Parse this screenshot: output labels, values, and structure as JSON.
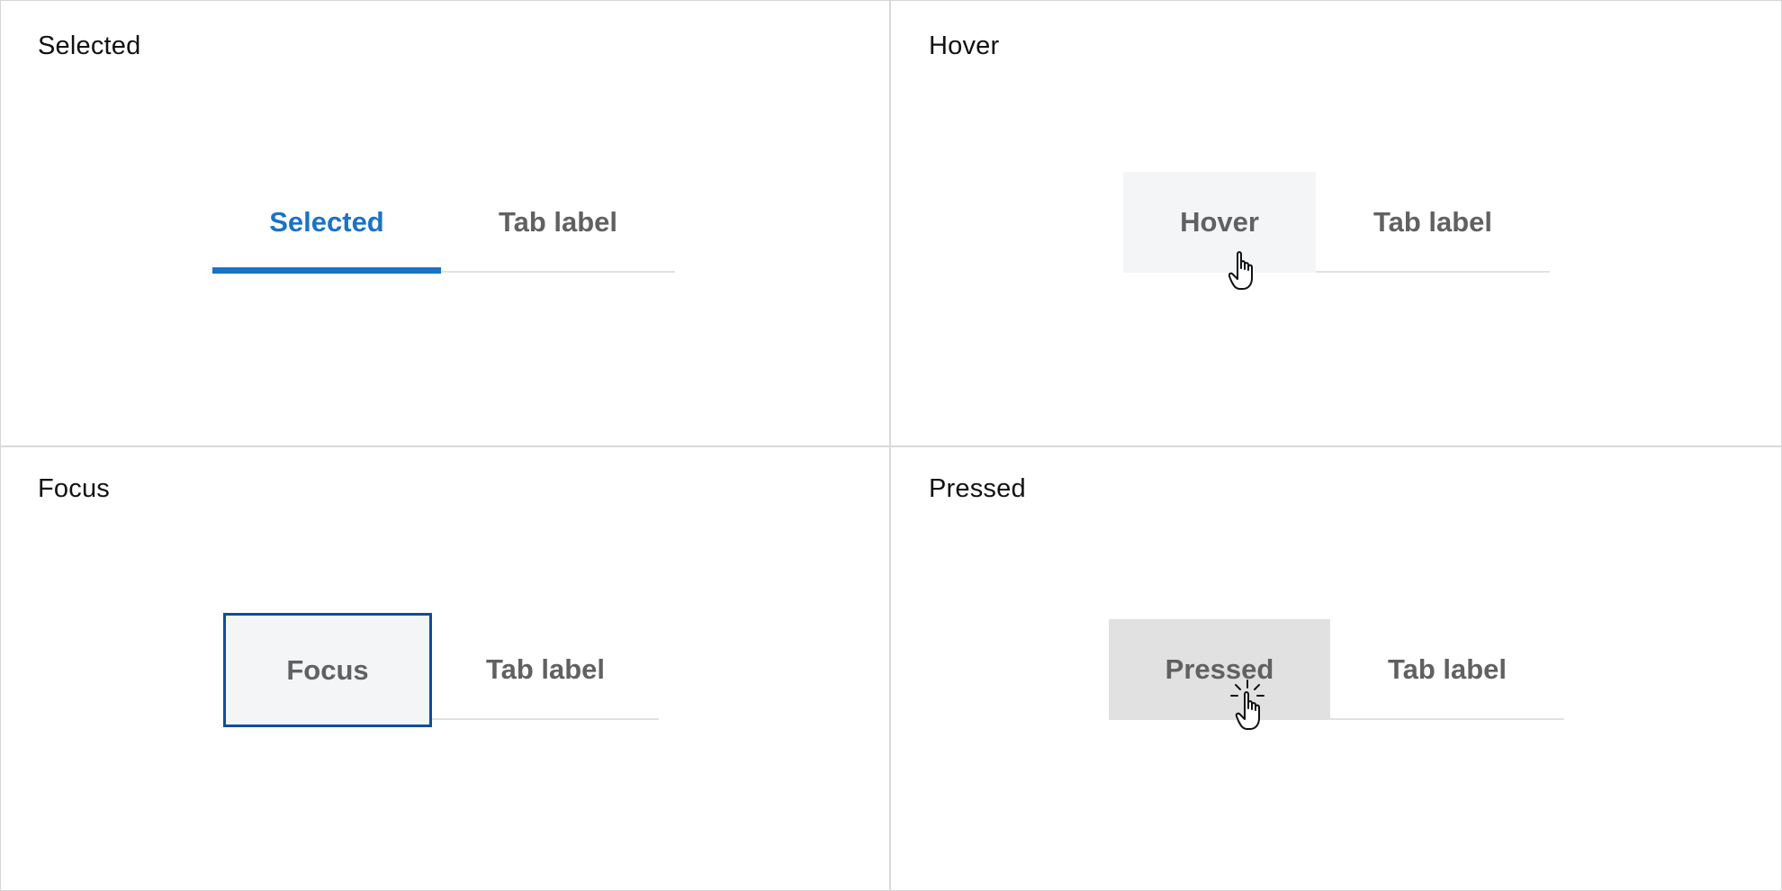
{
  "quadrants": {
    "selected": {
      "title": "Selected",
      "tabs": [
        {
          "label": "Selected",
          "state": "selected"
        },
        {
          "label": "Tab label",
          "state": "default"
        }
      ]
    },
    "hover": {
      "title": "Hover",
      "tabs": [
        {
          "label": "Hover",
          "state": "hover"
        },
        {
          "label": "Tab label",
          "state": "default"
        }
      ]
    },
    "focus": {
      "title": "Focus",
      "tabs": [
        {
          "label": "Focus",
          "state": "focus"
        },
        {
          "label": "Tab label",
          "state": "default"
        }
      ]
    },
    "pressed": {
      "title": "Pressed",
      "tabs": [
        {
          "label": "Pressed",
          "state": "pressed"
        },
        {
          "label": "Tab label",
          "state": "default"
        }
      ]
    }
  },
  "cursors": {
    "hover": "hand-pointer-icon",
    "pressed": "hand-pointer-click-icon"
  },
  "colors": {
    "accent": "#1a73c6",
    "focus_ring": "#0b4e9e",
    "hover_bg": "#f4f5f7",
    "pressed_bg": "#e1e1e1",
    "tab_text": "#616161",
    "baseline": "#e1e1e1",
    "divider": "#d9d9d9"
  }
}
